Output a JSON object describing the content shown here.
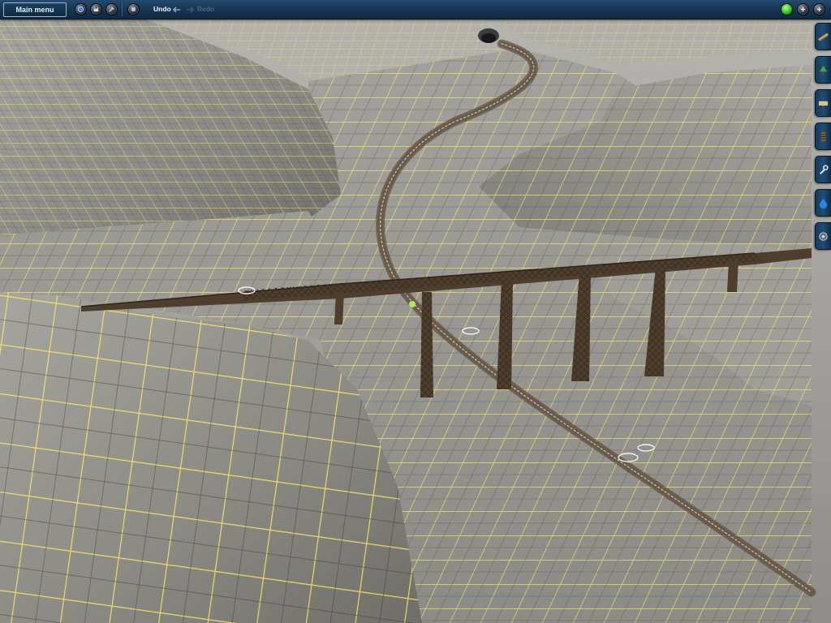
{
  "toolbar": {
    "main_menu_label": "Main menu",
    "undo_label": "Undo",
    "redo_label": "Redo",
    "left_buttons": [
      "globe-icon",
      "save-icon",
      "tools-icon",
      "info-icon"
    ],
    "right_buttons": [
      "status-light-icon",
      "add-icon",
      "minus-icon"
    ]
  },
  "sidebar": {
    "tabs": [
      "track-tool-icon",
      "tree-icon",
      "train-icon",
      "rail-icon",
      "wrench-icon",
      "water-icon",
      "settings-icon"
    ]
  },
  "colors": {
    "toolbar_bg": "#143350",
    "terrain": "#8e8c88",
    "grid": "#ffe86a",
    "bridge": "#4e3e2e",
    "track": "#5b4a3b"
  }
}
